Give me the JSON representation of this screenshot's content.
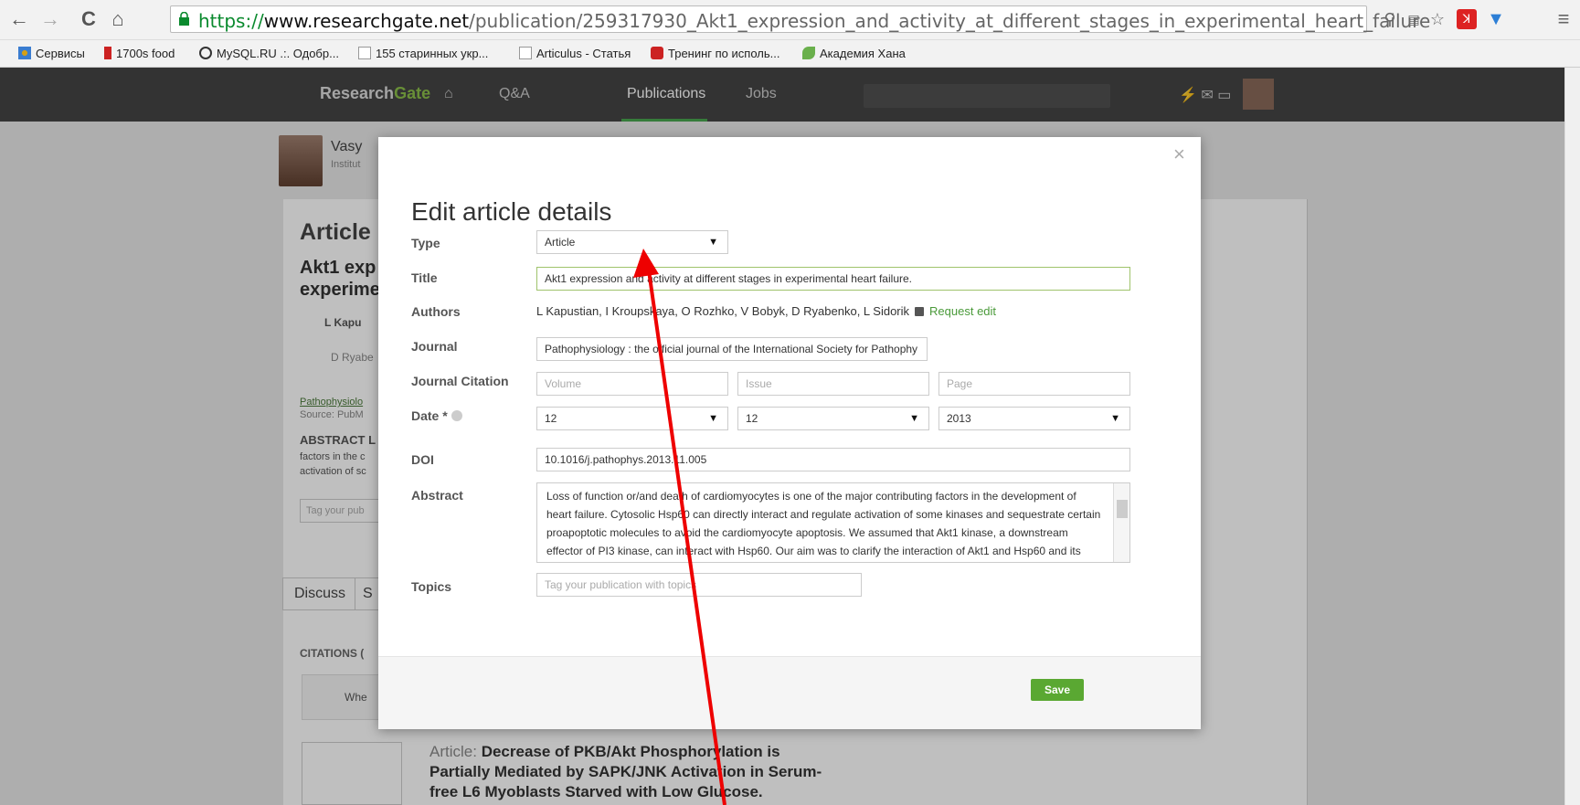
{
  "browser": {
    "url_scheme": "https://",
    "url_host": "www.researchgate.net",
    "url_path": "/publication/259317930_Akt1_expression_and_activity_at_different_stages_in_experimental_heart_failure",
    "bookmarks": [
      {
        "label": "Сервисы",
        "icon_color": "#d4a017"
      },
      {
        "label": "1700s food",
        "icon_color": "#cc2222"
      },
      {
        "label": "MySQL.RU .:. Одобр...",
        "icon_color": "#333333"
      },
      {
        "label": "155 старинных укр...",
        "icon_color": "#cccccc"
      },
      {
        "label": "Articulus - Статья",
        "icon_color": "#cccccc"
      },
      {
        "label": "Тренинг по исполь...",
        "icon_color": "#cc2222"
      },
      {
        "label": "Академия Хана",
        "icon_color": "#6ab04c"
      }
    ]
  },
  "site": {
    "logo_main": "Research",
    "logo_accent": "Gate",
    "nav": {
      "qa": "Q&A",
      "publications": "Publications",
      "jobs": "Jobs"
    }
  },
  "background": {
    "profile_name": "Vasy",
    "profile_inst": "Institut",
    "article_heading": "Article",
    "title_line1": "Akt1 exp",
    "title_line2": "experime",
    "author1": "L Kapu",
    "author2": "D Ryabe",
    "journal_link": "Pathophysiolo",
    "source": "Source: PubM",
    "abstract_label": "ABSTRACT L",
    "abs_line1": "factors in the c",
    "abs_line2": "activation of sc",
    "tag_placeholder": "Tag your pub",
    "discuss": "Discuss",
    "discuss2": "S",
    "citations": "CITATIONS (",
    "cit_item": "Whe",
    "bottom_prefix": "Article: ",
    "bottom_title": "Decrease of PKB/Akt Phosphorylation is Partially Mediated by SAPK/JNK Activation in Serum-free L6 Myoblasts Starved with Low Glucose."
  },
  "modal": {
    "title": "Edit article details",
    "close": "×",
    "labels": {
      "type": "Type",
      "title": "Title",
      "authors": "Authors",
      "journal": "Journal",
      "journal_citation": "Journal Citation",
      "date": "Date *",
      "doi": "DOI",
      "abstract": "Abstract",
      "topics": "Topics"
    },
    "type_value": "Article",
    "title_value": "Akt1 expression and activity at different stages in experimental heart failure.",
    "authors_value": "L Kapustian, I Kroupskaya, O Rozhko, V Bobyk, D Ryabenko, L Sidorik",
    "request_edit": "Request edit",
    "journal_value": "Pathophysiology : the official journal of the International Society for Pathophy",
    "volume_ph": "Volume",
    "issue_ph": "Issue",
    "page_ph": "Page",
    "date_day": "12",
    "date_month": "12",
    "date_year": "2013",
    "doi_value": "10.1016/j.pathophys.2013.11.005",
    "abstract_value": "Loss of function or/and death of cardiomyocytes is one of the major contributing factors in the development of heart failure. Cytosolic Hsp60 can directly interact and regulate activation of some kinases and sequestrate certain proapoptotic molecules to avoid the cardiomyocyte apoptosis. We assumed that Akt1 kinase, a downstream effector of PI3 kinase, can interact with Hsp60. Our aim was to clarify the interaction of Akt1 and Hsp60 and its dependence on the stage of heart failure.",
    "topics_ph": "Tag your publication with topics",
    "save": "Save"
  },
  "annotation": {
    "arrow_color": "#ee0000"
  }
}
